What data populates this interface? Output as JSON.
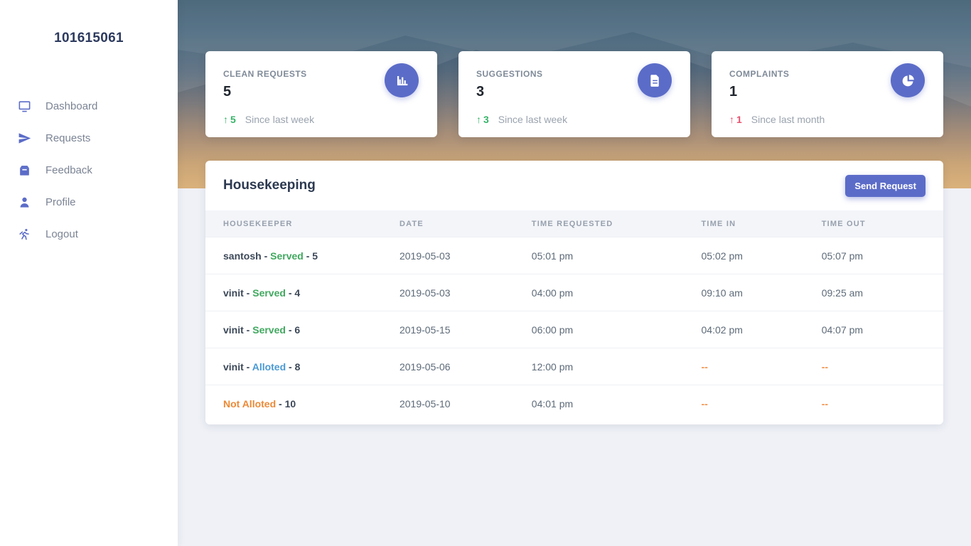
{
  "sidebar": {
    "title": "101615061",
    "items": [
      {
        "label": "Dashboard",
        "icon": "monitor-icon"
      },
      {
        "label": "Requests",
        "icon": "paper-plane-icon"
      },
      {
        "label": "Feedback",
        "icon": "archive-box-icon"
      },
      {
        "label": "Profile",
        "icon": "user-icon"
      },
      {
        "label": "Logout",
        "icon": "running-man-icon"
      }
    ]
  },
  "stats": [
    {
      "label": "CLEAN REQUESTS",
      "value": "5",
      "delta_arrow": "↑",
      "delta": "5",
      "caption": "Since last week",
      "trend": "up",
      "icon": "bar-chart-icon"
    },
    {
      "label": "SUGGESTIONS",
      "value": "3",
      "delta_arrow": "↑",
      "delta": "3",
      "caption": "Since last week",
      "trend": "up",
      "icon": "document-icon"
    },
    {
      "label": "COMPLAINTS",
      "value": "1",
      "delta_arrow": "↑",
      "delta": "1",
      "caption": "Since last month",
      "trend": "up",
      "icon": "pie-chart-icon"
    }
  ],
  "housekeeping": {
    "title": "Housekeeping",
    "send_button": "Send Request",
    "columns": [
      "HOUSEKEEPER",
      "DATE",
      "TIME REQUESTED",
      "TIME IN",
      "TIME OUT"
    ],
    "rows": [
      {
        "name_parts": [
          {
            "text": "santosh - "
          },
          {
            "text": "Served",
            "class": "green"
          },
          {
            "text": " - 5"
          }
        ],
        "date": "2019-05-03",
        "time_requested": "05:01 pm",
        "time_in": "05:02 pm",
        "time_out": "05:07 pm"
      },
      {
        "name_parts": [
          {
            "text": "vinit - "
          },
          {
            "text": "Served",
            "class": "green"
          },
          {
            "text": " - 4"
          }
        ],
        "date": "2019-05-03",
        "time_requested": "04:00 pm",
        "time_in": "09:10 am",
        "time_out": "09:25 am"
      },
      {
        "name_parts": [
          {
            "text": "vinit - "
          },
          {
            "text": "Served",
            "class": "green"
          },
          {
            "text": " - 6"
          }
        ],
        "date": "2019-05-15",
        "time_requested": "06:00 pm",
        "time_in": "04:02 pm",
        "time_out": "04:07 pm"
      },
      {
        "name_parts": [
          {
            "text": "vinit - "
          },
          {
            "text": "Alloted",
            "class": "blue"
          },
          {
            "text": " - 8"
          }
        ],
        "date": "2019-05-06",
        "time_requested": "12:00 pm",
        "time_in": "--",
        "time_out": "--"
      },
      {
        "name_parts": [
          {
            "text": "Not Alloted",
            "class": "orange"
          },
          {
            "text": " - 10"
          }
        ],
        "date": "2019-05-10",
        "time_requested": "04:01 pm",
        "time_in": "--",
        "time_out": "--"
      }
    ]
  },
  "colors": {
    "accent_indigo": "#5b6cc8",
    "green": "#41a85f",
    "delta_green": "#36b368",
    "delta_red": "#e8506e",
    "status_blue": "#4a9ad4",
    "status_orange": "#ed8936",
    "empty_dash_orange": "#f0934c",
    "hero_top": "#2e4f66",
    "hero_bottom": "#d9b17b",
    "page_background": "#eff1f7"
  }
}
